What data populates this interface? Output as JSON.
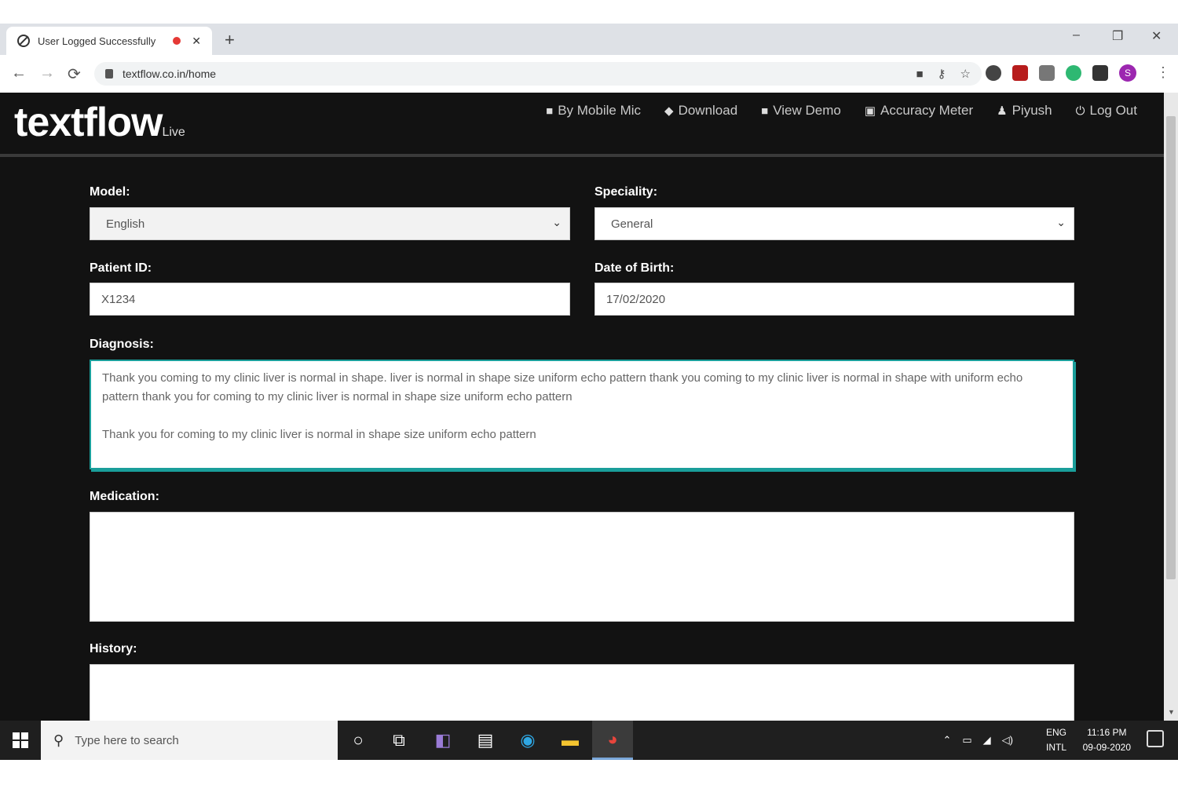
{
  "browser": {
    "tab_title": "User Logged Successfully",
    "new_tab": "+",
    "window_controls": {
      "minimize": "–",
      "restore": "❐",
      "close": "✕"
    },
    "url": "textflow.co.in/home",
    "nav": {
      "back": "←",
      "forward": "→",
      "reload": "⟳"
    },
    "omnibox_icons": [
      "camera-icon",
      "key-icon",
      "star-icon"
    ],
    "extensions": [
      {
        "name": "clock-extension-icon",
        "color": "#444444"
      },
      {
        "name": "pdf-extension-icon",
        "color": "#b71c1c"
      },
      {
        "name": "cloud-extension-icon",
        "color": "#777777"
      },
      {
        "name": "green-extension-icon",
        "color": "#2eb872"
      },
      {
        "name": "puzzle-extension-icon",
        "color": "#333333"
      }
    ],
    "profile_initial": "S",
    "menu": "⋮"
  },
  "app": {
    "logo": "textflow",
    "logo_suffix": "Live",
    "nav_links": [
      {
        "label": "By Mobile Mic",
        "icon": "microphone-icon"
      },
      {
        "label": "Download",
        "icon": "android-icon"
      },
      {
        "label": "View Demo",
        "icon": "video-icon"
      },
      {
        "label": "Accuracy Meter",
        "icon": "meter-icon"
      },
      {
        "label": "Piyush",
        "icon": "user-icon"
      },
      {
        "label": "Log Out",
        "icon": "logout-icon"
      }
    ],
    "colors": {
      "background": "#121212",
      "focus_accent": "#1a9e9a"
    }
  },
  "form": {
    "model": {
      "label": "Model:",
      "value": "English"
    },
    "speciality": {
      "label": "Speciality:",
      "value": "General"
    },
    "patient_id": {
      "label": "Patient ID:",
      "value": "X1234"
    },
    "dob": {
      "label": "Date of Birth:",
      "value": "17/02/2020"
    },
    "diagnosis": {
      "label": "Diagnosis:",
      "line1": "Thank you coming to my clinic liver is normal in shape. liver is normal in shape size uniform echo pattern thank you coming to my clinic liver is normal in shape with uniform echo pattern thank you for coming to my clinic liver is normal in shape size uniform echo pattern",
      "line2": "Thank you for coming to my clinic liver is normal in shape size uniform echo pattern"
    },
    "medication": {
      "label": "Medication:",
      "value": ""
    },
    "history": {
      "label": "History:",
      "value": ""
    }
  },
  "taskbar": {
    "search_placeholder": "Type here to search",
    "apps": [
      "cortana-icon",
      "task-view-icon",
      "visual-studio-icon",
      "store-icon",
      "edge-icon",
      "file-explorer-icon",
      "chrome-icon"
    ],
    "lang_line1": "ENG",
    "lang_line2": "INTL",
    "time": "11:16 PM",
    "date": "09-09-2020"
  }
}
